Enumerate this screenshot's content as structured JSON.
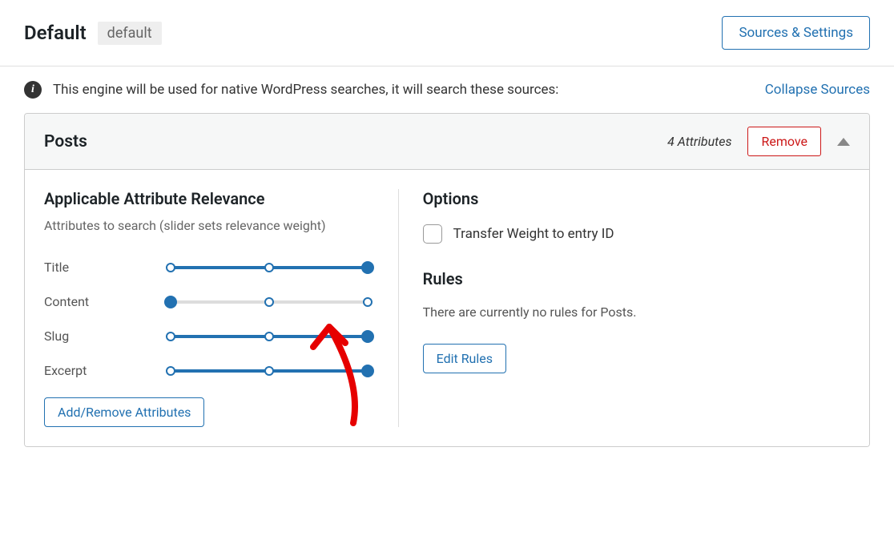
{
  "header": {
    "title": "Default",
    "badge": "default",
    "settings_button": "Sources & Settings"
  },
  "info": {
    "text": "This engine will be used for native WordPress searches, it will search these sources:",
    "collapse_link": "Collapse Sources"
  },
  "panel": {
    "title": "Posts",
    "attr_count": "4 Attributes",
    "remove_button": "Remove"
  },
  "left": {
    "heading": "Applicable Attribute Relevance",
    "sub": "Attributes to search (slider sets relevance weight)",
    "sliders": [
      {
        "label": "Title",
        "value": 2
      },
      {
        "label": "Content",
        "value": 0
      },
      {
        "label": "Slug",
        "value": 2
      },
      {
        "label": "Excerpt",
        "value": 2
      }
    ],
    "add_remove_button": "Add/Remove Attributes"
  },
  "right": {
    "options_heading": "Options",
    "checkbox_label": "Transfer Weight to entry ID",
    "rules_heading": "Rules",
    "rules_text": "There are currently no rules for Posts.",
    "edit_rules_button": "Edit Rules"
  }
}
